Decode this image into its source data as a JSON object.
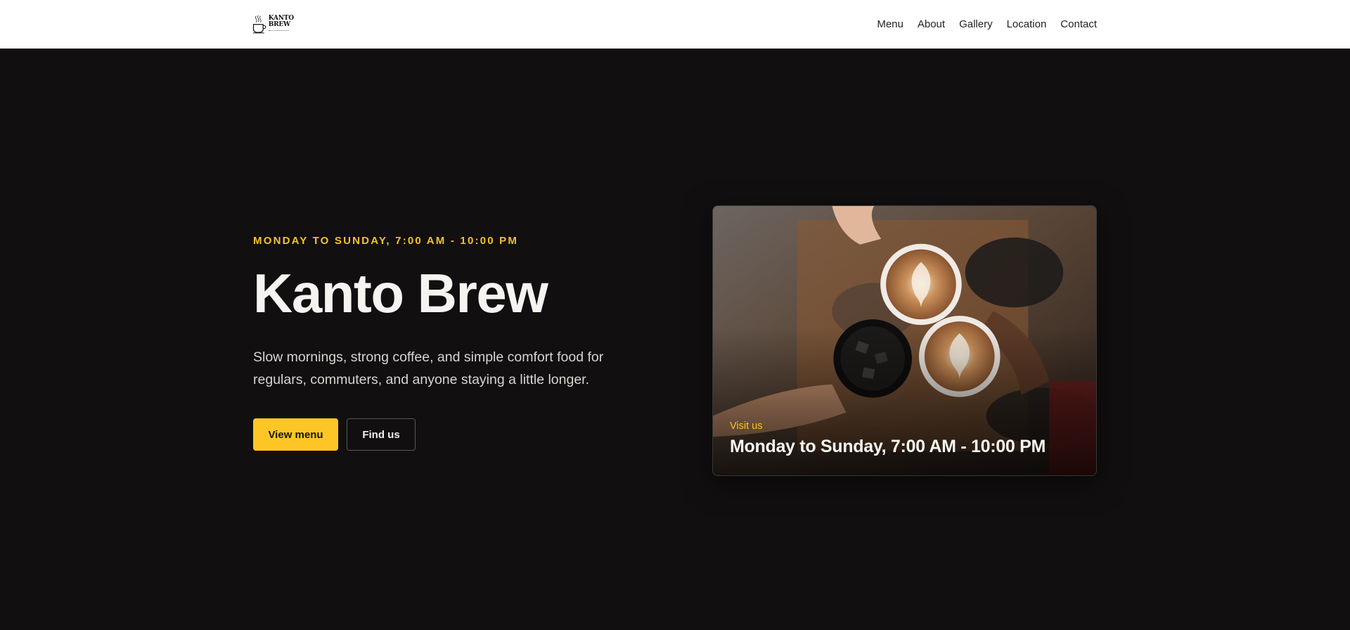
{
  "header": {
    "logo": {
      "wordmark": "KANTO BREW",
      "icon": "coffee-cup-icon"
    },
    "nav": [
      {
        "label": "Menu"
      },
      {
        "label": "About"
      },
      {
        "label": "Gallery"
      },
      {
        "label": "Location"
      },
      {
        "label": "Contact"
      }
    ]
  },
  "hero": {
    "eyebrow": "MONDAY TO SUNDAY, 7:00 AM - 10:00 PM",
    "title": "Kanto Brew",
    "description": "Slow mornings, strong coffee, and simple comfort food for regulars, commuters, and anyone staying a little longer.",
    "primary_button": "View menu",
    "secondary_button": "Find us"
  },
  "card": {
    "kicker": "Visit us",
    "hours": "Monday to Sunday, 7:00 AM - 10:00 PM"
  },
  "colors": {
    "accent": "#fdc626",
    "background": "#110f10",
    "header_bg": "#ffffff"
  }
}
